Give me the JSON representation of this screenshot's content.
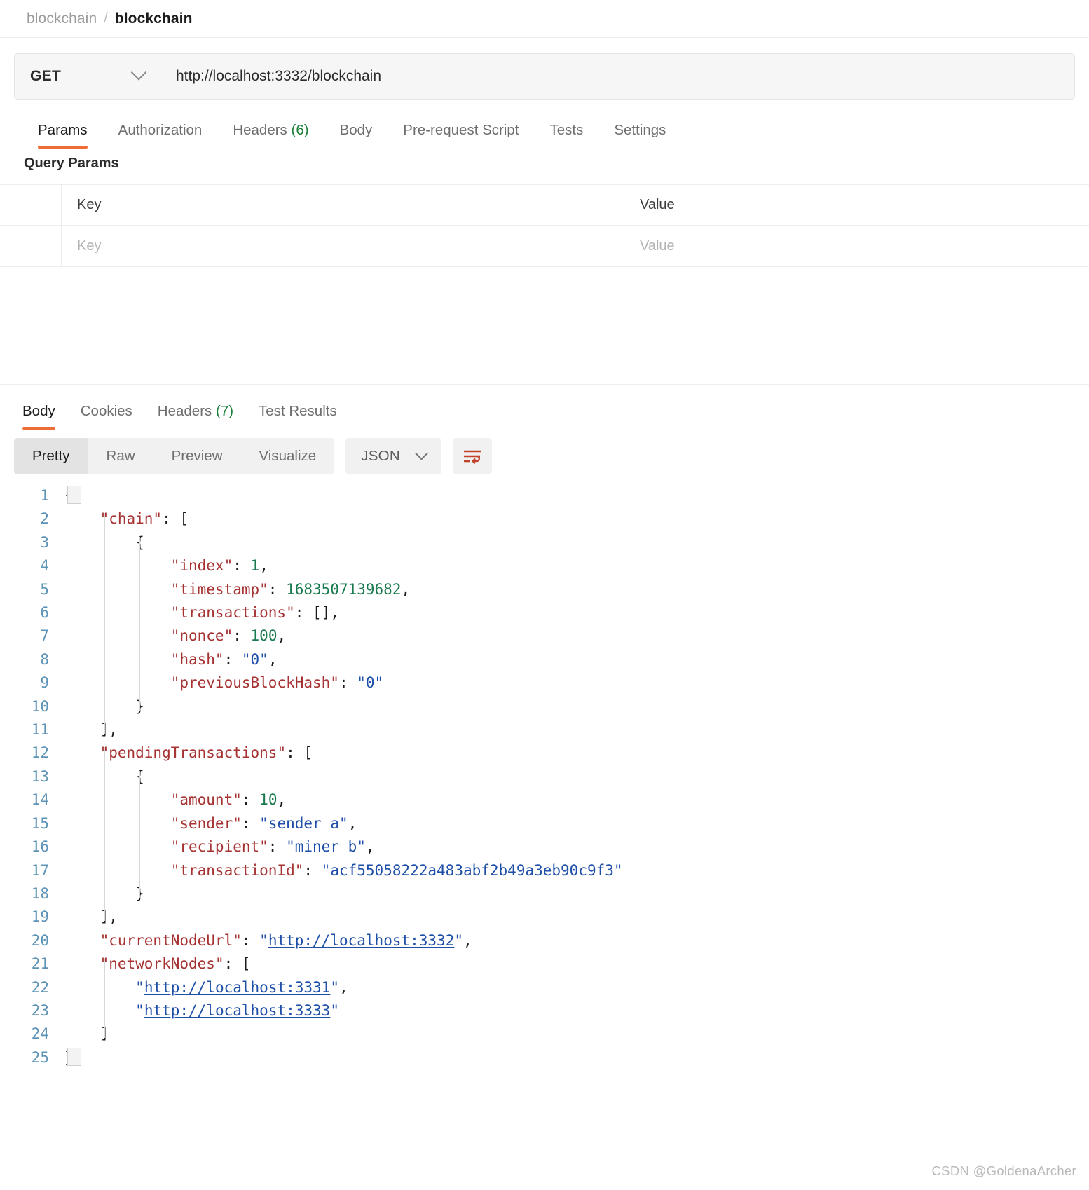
{
  "breadcrumb": {
    "root": "blockchain",
    "separator": "/",
    "current": "blockchain"
  },
  "request": {
    "method": "GET",
    "url": "http://localhost:3332/blockchain",
    "tabs": [
      {
        "label": "Params",
        "count": "",
        "active": true
      },
      {
        "label": "Authorization",
        "count": "",
        "active": false
      },
      {
        "label": "Headers",
        "count": "(6)",
        "active": false
      },
      {
        "label": "Body",
        "count": "",
        "active": false
      },
      {
        "label": "Pre-request Script",
        "count": "",
        "active": false
      },
      {
        "label": "Tests",
        "count": "",
        "active": false
      },
      {
        "label": "Settings",
        "count": "",
        "active": false
      }
    ],
    "query_params_title": "Query Params",
    "table": {
      "headers": {
        "key": "Key",
        "value": "Value"
      },
      "row_placeholders": {
        "key": "Key",
        "value": "Value"
      }
    }
  },
  "response": {
    "tabs": [
      {
        "label": "Body",
        "count": "",
        "active": true
      },
      {
        "label": "Cookies",
        "count": "",
        "active": false
      },
      {
        "label": "Headers",
        "count": "(7)",
        "active": false
      },
      {
        "label": "Test Results",
        "count": "",
        "active": false
      }
    ],
    "view_modes": [
      {
        "label": "Pretty",
        "active": true
      },
      {
        "label": "Raw",
        "active": false
      },
      {
        "label": "Preview",
        "active": false
      },
      {
        "label": "Visualize",
        "active": false
      }
    ],
    "format": "JSON",
    "wrap_icon": "word-wrap-icon",
    "accent_color": "#ef6c34",
    "wrap_icon_color": "#c0432a",
    "body_lines": [
      {
        "n": 1,
        "indent": 0,
        "tokens": [
          {
            "t": "{",
            "c": "p"
          }
        ]
      },
      {
        "n": 2,
        "indent": 1,
        "tokens": [
          {
            "t": "\"chain\"",
            "c": "k"
          },
          {
            "t": ": [",
            "c": "p"
          }
        ]
      },
      {
        "n": 3,
        "indent": 2,
        "tokens": [
          {
            "t": "{",
            "c": "p"
          }
        ]
      },
      {
        "n": 4,
        "indent": 3,
        "tokens": [
          {
            "t": "\"index\"",
            "c": "k"
          },
          {
            "t": ": ",
            "c": "p"
          },
          {
            "t": "1",
            "c": "n"
          },
          {
            "t": ",",
            "c": "p"
          }
        ]
      },
      {
        "n": 5,
        "indent": 3,
        "tokens": [
          {
            "t": "\"timestamp\"",
            "c": "k"
          },
          {
            "t": ": ",
            "c": "p"
          },
          {
            "t": "1683507139682",
            "c": "n"
          },
          {
            "t": ",",
            "c": "p"
          }
        ]
      },
      {
        "n": 6,
        "indent": 3,
        "tokens": [
          {
            "t": "\"transactions\"",
            "c": "k"
          },
          {
            "t": ": [],",
            "c": "p"
          }
        ]
      },
      {
        "n": 7,
        "indent": 3,
        "tokens": [
          {
            "t": "\"nonce\"",
            "c": "k"
          },
          {
            "t": ": ",
            "c": "p"
          },
          {
            "t": "100",
            "c": "n"
          },
          {
            "t": ",",
            "c": "p"
          }
        ]
      },
      {
        "n": 8,
        "indent": 3,
        "tokens": [
          {
            "t": "\"hash\"",
            "c": "k"
          },
          {
            "t": ": ",
            "c": "p"
          },
          {
            "t": "\"0\"",
            "c": "s"
          },
          {
            "t": ",",
            "c": "p"
          }
        ]
      },
      {
        "n": 9,
        "indent": 3,
        "tokens": [
          {
            "t": "\"previousBlockHash\"",
            "c": "k"
          },
          {
            "t": ": ",
            "c": "p"
          },
          {
            "t": "\"0\"",
            "c": "s"
          }
        ]
      },
      {
        "n": 10,
        "indent": 2,
        "tokens": [
          {
            "t": "}",
            "c": "p"
          }
        ]
      },
      {
        "n": 11,
        "indent": 1,
        "tokens": [
          {
            "t": "],",
            "c": "p"
          }
        ]
      },
      {
        "n": 12,
        "indent": 1,
        "tokens": [
          {
            "t": "\"pendingTransactions\"",
            "c": "k"
          },
          {
            "t": ": [",
            "c": "p"
          }
        ]
      },
      {
        "n": 13,
        "indent": 2,
        "tokens": [
          {
            "t": "{",
            "c": "p"
          }
        ]
      },
      {
        "n": 14,
        "indent": 3,
        "tokens": [
          {
            "t": "\"amount\"",
            "c": "k"
          },
          {
            "t": ": ",
            "c": "p"
          },
          {
            "t": "10",
            "c": "n"
          },
          {
            "t": ",",
            "c": "p"
          }
        ]
      },
      {
        "n": 15,
        "indent": 3,
        "tokens": [
          {
            "t": "\"sender\"",
            "c": "k"
          },
          {
            "t": ": ",
            "c": "p"
          },
          {
            "t": "\"sender a\"",
            "c": "s"
          },
          {
            "t": ",",
            "c": "p"
          }
        ]
      },
      {
        "n": 16,
        "indent": 3,
        "tokens": [
          {
            "t": "\"recipient\"",
            "c": "k"
          },
          {
            "t": ": ",
            "c": "p"
          },
          {
            "t": "\"miner b\"",
            "c": "s"
          },
          {
            "t": ",",
            "c": "p"
          }
        ]
      },
      {
        "n": 17,
        "indent": 3,
        "tokens": [
          {
            "t": "\"transactionId\"",
            "c": "k"
          },
          {
            "t": ": ",
            "c": "p"
          },
          {
            "t": "\"acf55058222a483abf2b49a3eb90c9f3\"",
            "c": "s"
          }
        ]
      },
      {
        "n": 18,
        "indent": 2,
        "tokens": [
          {
            "t": "}",
            "c": "p"
          }
        ]
      },
      {
        "n": 19,
        "indent": 1,
        "tokens": [
          {
            "t": "],",
            "c": "p"
          }
        ]
      },
      {
        "n": 20,
        "indent": 1,
        "tokens": [
          {
            "t": "\"currentNodeUrl\"",
            "c": "k"
          },
          {
            "t": ": ",
            "c": "p"
          },
          {
            "t": "\"",
            "c": "s"
          },
          {
            "t": "http://localhost:3332",
            "c": "lnk"
          },
          {
            "t": "\"",
            "c": "s"
          },
          {
            "t": ",",
            "c": "p"
          }
        ]
      },
      {
        "n": 21,
        "indent": 1,
        "tokens": [
          {
            "t": "\"networkNodes\"",
            "c": "k"
          },
          {
            "t": ": [",
            "c": "p"
          }
        ]
      },
      {
        "n": 22,
        "indent": 2,
        "tokens": [
          {
            "t": "\"",
            "c": "s"
          },
          {
            "t": "http://localhost:3331",
            "c": "lnk"
          },
          {
            "t": "\"",
            "c": "s"
          },
          {
            "t": ",",
            "c": "p"
          }
        ]
      },
      {
        "n": 23,
        "indent": 2,
        "tokens": [
          {
            "t": "\"",
            "c": "s"
          },
          {
            "t": "http://localhost:3333",
            "c": "lnk"
          },
          {
            "t": "\"",
            "c": "s"
          }
        ]
      },
      {
        "n": 24,
        "indent": 1,
        "tokens": [
          {
            "t": "]",
            "c": "p"
          }
        ]
      },
      {
        "n": 25,
        "indent": 0,
        "tokens": [
          {
            "t": "}",
            "c": "p"
          }
        ]
      }
    ]
  },
  "watermark": "CSDN @GoldenaArcher"
}
